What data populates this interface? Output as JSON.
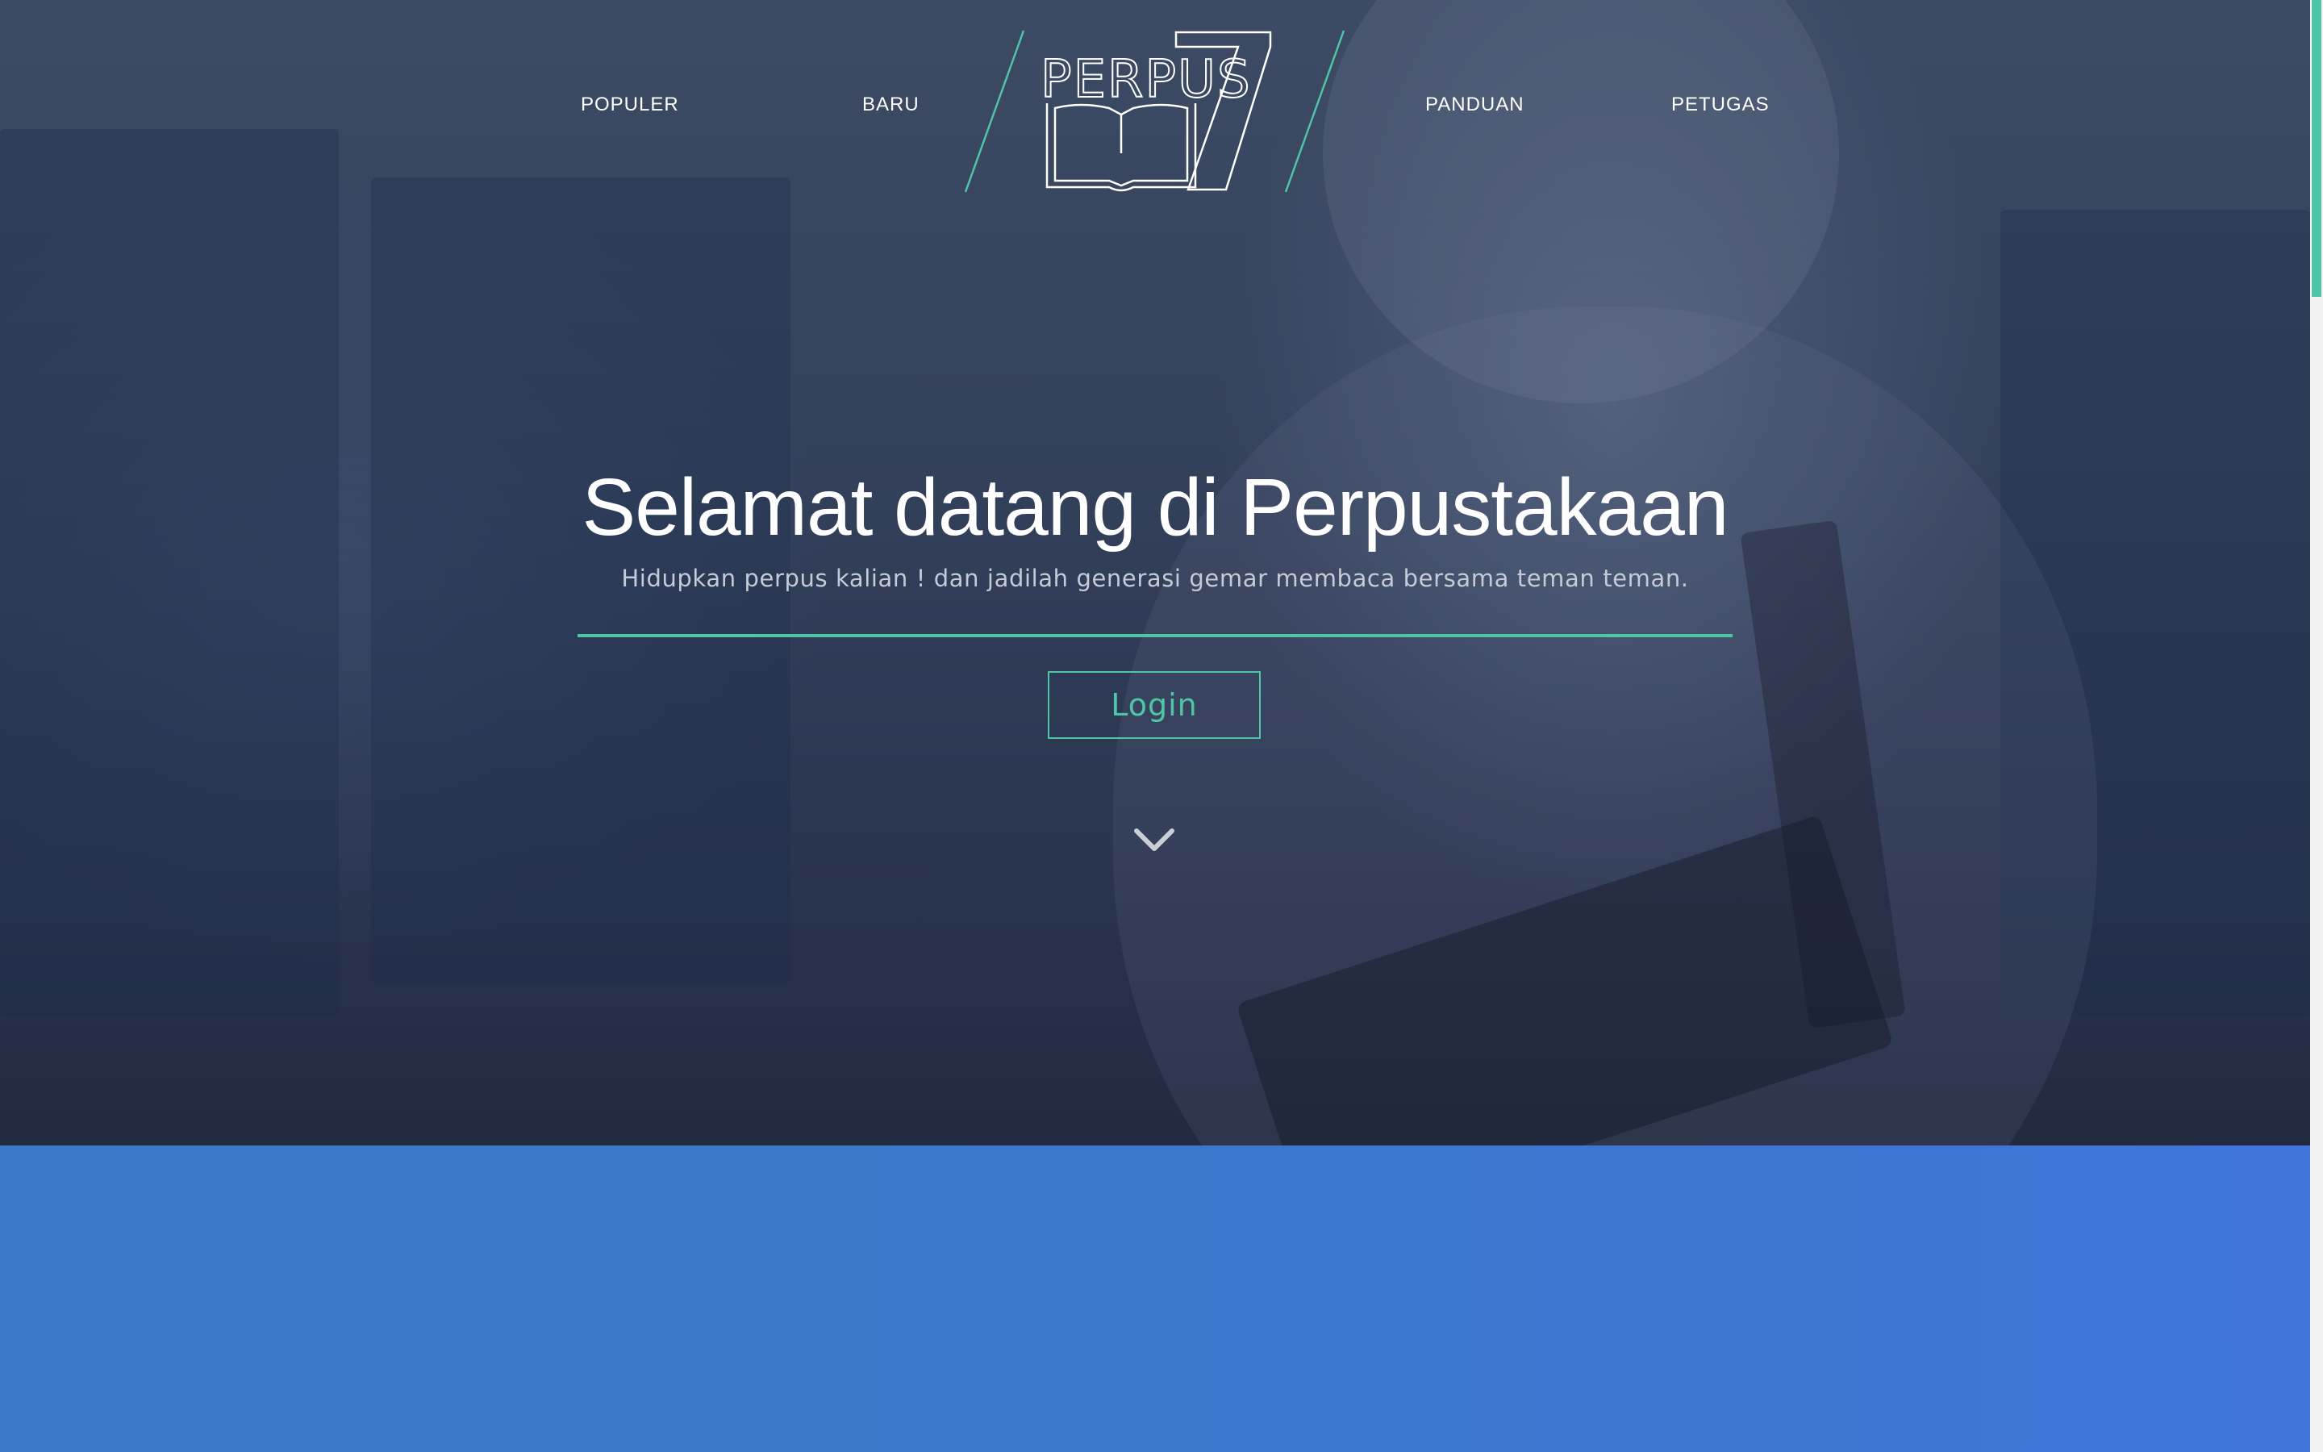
{
  "nav": {
    "items": [
      {
        "label": "POPULER"
      },
      {
        "label": "BARU"
      },
      {
        "label": "PANDUAN"
      },
      {
        "label": "PETUGAS"
      }
    ]
  },
  "logo": {
    "text": "PERPUS",
    "number": "7"
  },
  "hero": {
    "title": "Selamat datang di Perpustakaan",
    "subtitle": "Hidupkan perpus kalian ! dan jadilah generasi gemar membaca bersama teman teman.",
    "login_label": "Login"
  },
  "colors": {
    "accent": "#4ec5a5",
    "hero_overlay": "#2f3b55",
    "section_blue": "#3b78cc"
  },
  "icons": {
    "scroll_down": "chevron-down-icon"
  }
}
